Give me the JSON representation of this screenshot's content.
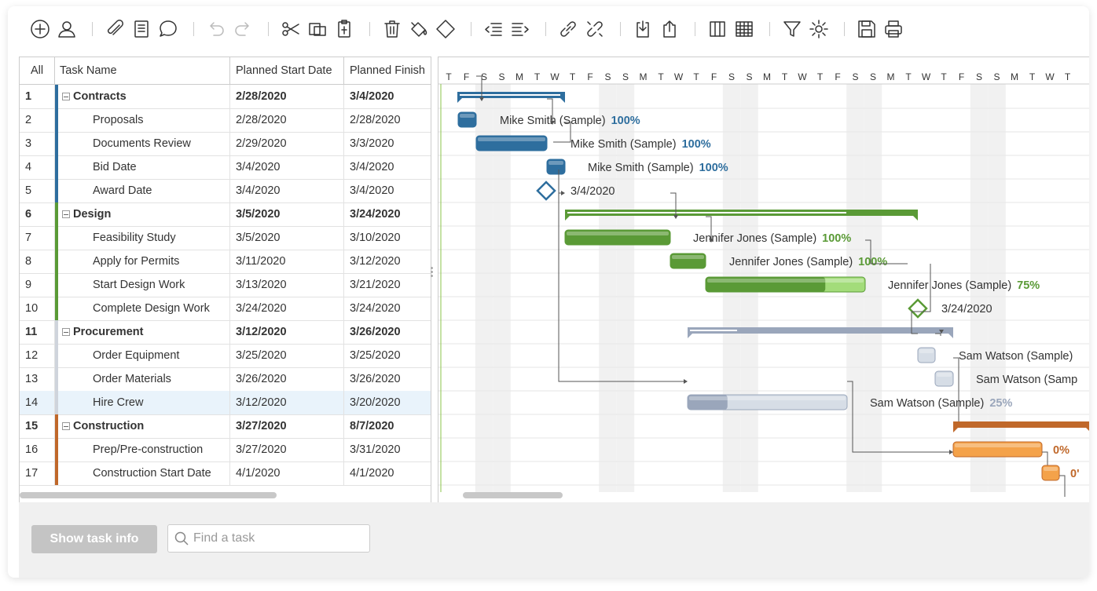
{
  "toolbar": {
    "icons": [
      "add-task",
      "add-user",
      "attach",
      "notes",
      "comment",
      "undo",
      "redo",
      "cut",
      "copy",
      "paste",
      "delete",
      "fill-color",
      "milestone",
      "outdent",
      "indent",
      "link",
      "unlink",
      "import",
      "export",
      "columns",
      "table",
      "filter",
      "settings",
      "save",
      "print"
    ]
  },
  "grid": {
    "headers": {
      "all": "All",
      "name": "Task Name",
      "start": "Planned Start Date",
      "finish": "Planned Finish"
    },
    "rows": [
      {
        "id": "1",
        "name": "Contracts",
        "start": "2/28/2020",
        "finish": "3/4/2020",
        "group": true,
        "color": "#2e6e9e"
      },
      {
        "id": "2",
        "name": "Proposals",
        "start": "2/28/2020",
        "finish": "2/28/2020",
        "group": false,
        "color": "#2e6e9e"
      },
      {
        "id": "3",
        "name": "Documents Review",
        "start": "2/29/2020",
        "finish": "3/3/2020",
        "group": false,
        "color": "#2e6e9e"
      },
      {
        "id": "4",
        "name": "Bid Date",
        "start": "3/4/2020",
        "finish": "3/4/2020",
        "group": false,
        "color": "#2e6e9e"
      },
      {
        "id": "5",
        "name": "Award Date",
        "start": "3/4/2020",
        "finish": "3/4/2020",
        "group": false,
        "color": "#2e6e9e"
      },
      {
        "id": "6",
        "name": "Design",
        "start": "3/5/2020",
        "finish": "3/24/2020",
        "group": true,
        "color": "#5a9a36"
      },
      {
        "id": "7",
        "name": "Feasibility Study",
        "start": "3/5/2020",
        "finish": "3/10/2020",
        "group": false,
        "color": "#5a9a36"
      },
      {
        "id": "8",
        "name": "Apply for Permits",
        "start": "3/11/2020",
        "finish": "3/12/2020",
        "group": false,
        "color": "#5a9a36"
      },
      {
        "id": "9",
        "name": "Start Design Work",
        "start": "3/13/2020",
        "finish": "3/21/2020",
        "group": false,
        "color": "#5a9a36"
      },
      {
        "id": "10",
        "name": "Complete Design Work",
        "start": "3/24/2020",
        "finish": "3/24/2020",
        "group": false,
        "color": "#5a9a36"
      },
      {
        "id": "11",
        "name": "Procurement",
        "start": "3/12/2020",
        "finish": "3/26/2020",
        "group": true,
        "color": "#cfd4dc"
      },
      {
        "id": "12",
        "name": "Order Equipment",
        "start": "3/25/2020",
        "finish": "3/25/2020",
        "group": false,
        "color": "#cfd4dc"
      },
      {
        "id": "13",
        "name": "Order Materials",
        "start": "3/26/2020",
        "finish": "3/26/2020",
        "group": false,
        "color": "#cfd4dc"
      },
      {
        "id": "14",
        "name": "Hire Crew",
        "start": "3/12/2020",
        "finish": "3/20/2020",
        "group": false,
        "color": "#cfd4dc"
      },
      {
        "id": "15",
        "name": "Construction",
        "start": "3/27/2020",
        "finish": "8/7/2020",
        "group": true,
        "color": "#c0682a"
      },
      {
        "id": "16",
        "name": "Prep/Pre-construction",
        "start": "3/27/2020",
        "finish": "3/31/2020",
        "group": false,
        "color": "#c0682a"
      },
      {
        "id": "17",
        "name": "Construction Start Date",
        "start": "4/1/2020",
        "finish": "4/1/2020",
        "group": false,
        "color": "#c0682a"
      }
    ]
  },
  "gantt": {
    "day_letters": [
      "T",
      "F",
      "S",
      "S",
      "M",
      "T",
      "W",
      "T",
      "F",
      "S",
      "S",
      "M",
      "T",
      "W",
      "T",
      "F",
      "S",
      "S",
      "M",
      "T",
      "W",
      "T",
      "F",
      "S",
      "S",
      "M",
      "T",
      "W",
      "T",
      "F",
      "S",
      "S",
      "M",
      "T",
      "W",
      "T"
    ],
    "bar_labels": [
      {
        "text": "Mike Smith (Sample)",
        "pct": "100%",
        "pct_color": "#2e6e9e"
      },
      {
        "text": "Mike Smith (Sample)",
        "pct": "100%",
        "pct_color": "#2e6e9e"
      },
      {
        "text": "Mike Smith (Sample)",
        "pct": "100%",
        "pct_color": "#2e6e9e"
      },
      {
        "text": "3/4/2020",
        "pct": "",
        "pct_color": "#2e6e9e"
      },
      {
        "text": "Jennifer Jones (Sample)",
        "pct": "100%",
        "pct_color": "#5a9a36"
      },
      {
        "text": "Jennifer Jones (Sample)",
        "pct": "100%",
        "pct_color": "#5a9a36"
      },
      {
        "text": "Jennifer Jones (Sample)",
        "pct": "75%",
        "pct_color": "#5a9a36"
      },
      {
        "text": "3/24/2020",
        "pct": "",
        "pct_color": "#5a9a36"
      },
      {
        "text": "Sam Watson (Sample)",
        "pct": "",
        "pct_color": "#9aa6bb"
      },
      {
        "text": "Sam Watson (Samp",
        "pct": "",
        "pct_color": "#9aa6bb"
      },
      {
        "text": "Sam Watson (Sample)",
        "pct": "25%",
        "pct_color": "#9aa6bb"
      },
      {
        "text": "",
        "pct": "0%",
        "pct_color": "#c0682a"
      },
      {
        "text": "",
        "pct": "0'",
        "pct_color": "#c0682a"
      }
    ]
  },
  "footer": {
    "show_task_info": "Show task info",
    "search_placeholder": "Find a task"
  }
}
